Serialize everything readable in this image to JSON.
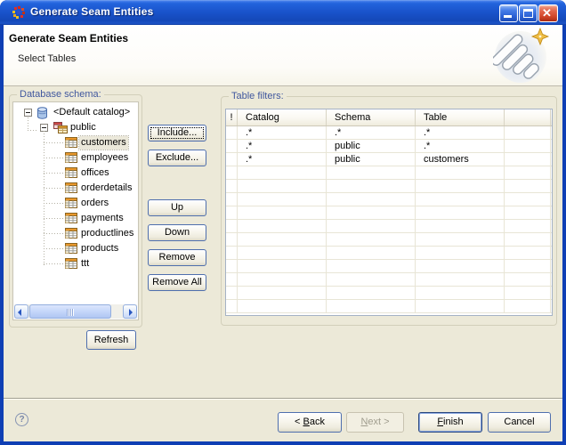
{
  "window": {
    "title": "Generate Seam Entities",
    "titlebar_icons": [
      "seam-app-icon",
      "minimize-icon",
      "maximize-icon",
      "close-icon"
    ]
  },
  "header": {
    "title": "Generate Seam Entities",
    "subtitle": "Select Tables",
    "image": "stacked-tables-wizard-graphic with gold sparkle"
  },
  "schema_group": {
    "label": "Database schema:",
    "tree": [
      {
        "label": "<Default catalog>",
        "depth": 0,
        "icon": "database-catalog-icon",
        "expander": "minus",
        "selected": false
      },
      {
        "label": "public",
        "depth": 1,
        "icon": "schema-icon",
        "expander": "minus",
        "selected": false
      },
      {
        "label": "customers",
        "depth": 2,
        "icon": "table-icon",
        "selected": true
      },
      {
        "label": "employees",
        "depth": 2,
        "icon": "table-icon",
        "selected": false
      },
      {
        "label": "offices",
        "depth": 2,
        "icon": "table-icon",
        "selected": false
      },
      {
        "label": "orderdetails",
        "depth": 2,
        "icon": "table-icon",
        "selected": false
      },
      {
        "label": "orders",
        "depth": 2,
        "icon": "table-icon",
        "selected": false
      },
      {
        "label": "payments",
        "depth": 2,
        "icon": "table-icon",
        "selected": false
      },
      {
        "label": "productlines",
        "depth": 2,
        "icon": "table-icon",
        "selected": false
      },
      {
        "label": "products",
        "depth": 2,
        "icon": "table-icon",
        "selected": false
      },
      {
        "label": "ttt",
        "depth": 2,
        "icon": "table-icon",
        "selected": false
      }
    ],
    "refresh_label": "Refresh"
  },
  "middle_buttons": {
    "include": "Include...",
    "exclude": "Exclude...",
    "up": "Up",
    "down": "Down",
    "remove": "Remove",
    "remove_all": "Remove All"
  },
  "filters_group": {
    "label": "Table filters:",
    "columns": [
      "!",
      "Catalog",
      "Schema",
      "Table",
      ""
    ],
    "rows": [
      [
        "",
        ".*",
        ".*",
        ".*",
        ""
      ],
      [
        "",
        ".*",
        "public",
        ".*",
        ""
      ],
      [
        "",
        ".*",
        "public",
        "customers",
        ""
      ]
    ],
    "total_rows": 14
  },
  "footer": {
    "help_icon": "?",
    "back": {
      "label": "< Back",
      "mnemonic": "B",
      "disabled": false
    },
    "next": {
      "label": "Next >",
      "mnemonic": "N",
      "disabled": true
    },
    "finish": {
      "label": "Finish",
      "mnemonic": "F",
      "default": true
    },
    "cancel": {
      "label": "Cancel"
    }
  },
  "colors": {
    "titlebar_blue": "#1953cb",
    "window_border_blue": "#0f3fb4",
    "body_beige": "#ece9d8",
    "group_label_blue": "#41589e",
    "table_header_orange": "#e8972c",
    "close_button_red": "#d1472a"
  }
}
